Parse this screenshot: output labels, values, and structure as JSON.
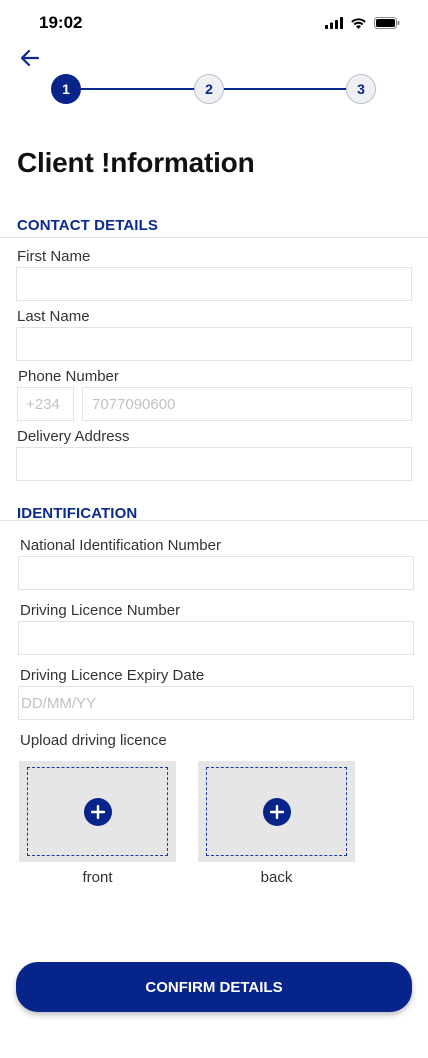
{
  "status_bar": {
    "time": "19:02",
    "icons": [
      "signal-icon",
      "wifi-icon",
      "battery-icon"
    ]
  },
  "navigation": {
    "back_icon": "arrow-left-icon"
  },
  "stepper": {
    "steps": [
      {
        "number": "1",
        "state": "active"
      },
      {
        "number": "2",
        "state": "inactive"
      },
      {
        "number": "3",
        "state": "inactive"
      }
    ]
  },
  "page": {
    "title": "Client !nformation"
  },
  "contact_details": {
    "heading": "CONTACT DETAILS",
    "first_name": {
      "label": "First Name",
      "value": "",
      "placeholder": ""
    },
    "last_name": {
      "label": "Last Name",
      "value": "",
      "placeholder": ""
    },
    "phone": {
      "label": "Phone Number",
      "country_code_placeholder": "+234",
      "number_placeholder": "7077090600"
    },
    "delivery_address": {
      "label": "Delivery Address",
      "value": "",
      "placeholder": ""
    }
  },
  "identification": {
    "heading": "IDENTIFICATION",
    "nin": {
      "label": "National Identification Number",
      "value": "",
      "placeholder": ""
    },
    "licence_number": {
      "label": "Driving Licence Number",
      "value": "",
      "placeholder": ""
    },
    "licence_expiry": {
      "label": "Driving Licence Expiry Date",
      "placeholder": "DD/MM/YY"
    },
    "upload": {
      "label": "Upload driving licence",
      "front_caption": "front",
      "back_caption": "back"
    }
  },
  "actions": {
    "confirm_label": "CONFIRM DETAILS"
  },
  "colors": {
    "primary": "#06248a",
    "heading": "#0a2a8f",
    "upload_bg": "#e6e6e6"
  }
}
